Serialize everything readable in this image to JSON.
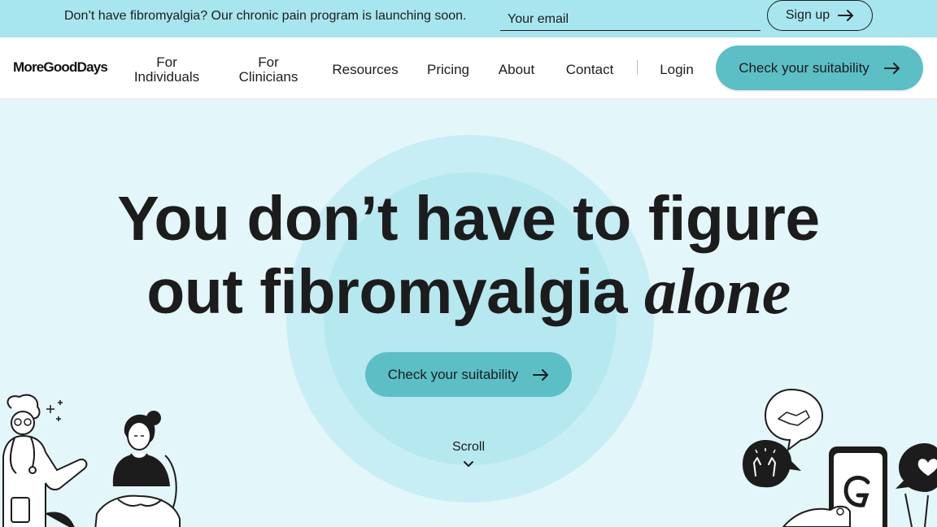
{
  "announcement": {
    "text": "Don’t have fibromyalgia? Our chronic pain program is launching soon.",
    "email_placeholder": "Your email",
    "signup_label": "Sign up",
    "signup_icon": "arrow-right-icon"
  },
  "nav": {
    "logo": "MoreGoodDays",
    "links": {
      "individuals": [
        "For",
        "Individuals"
      ],
      "clinicians": [
        "For",
        "Clinicians"
      ],
      "resources": "Resources",
      "pricing": "Pricing",
      "about": "About",
      "contact": "Contact"
    },
    "login": "Login",
    "cta_label": "Check your suitability",
    "cta_icon": "arrow-right-icon"
  },
  "hero": {
    "headline_line1": "You don’t have to figure",
    "headline_line2": "out fibromyalgia",
    "headline_emphasis": "alone",
    "cta_label": "Check your suitability",
    "cta_icon": "arrow-right-icon",
    "scroll_label": "Scroll",
    "scroll_icon": "chevron-down-icon"
  },
  "colors": {
    "announcement_bg": "#a8e6ef",
    "accent": "#5bbfc5",
    "hero_bg": "#e3f6f9",
    "text": "#1c1c1c"
  }
}
